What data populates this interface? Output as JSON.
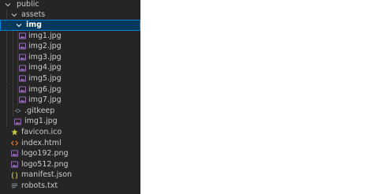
{
  "explorer": {
    "tree": {
      "public": "public",
      "assets": "assets",
      "img": "img",
      "img_files": [
        "img1.jpg",
        "img2.jpg",
        "img3.jpg",
        "img4.jpg",
        "img5.jpg",
        "img6.jpg",
        "img7.jpg"
      ],
      "gitkeep": ".gitkeep",
      "assets_img1": "img1.jpg",
      "favicon": "favicon.ico",
      "index": "index.html",
      "logo192": "logo192.png",
      "logo512": "logo512.png",
      "manifest": "manifest.json",
      "robots": "robots.txt"
    }
  },
  "colors": {
    "sidebar_bg": "#252526",
    "selection_bg": "#04395e",
    "selection_border": "#007fd4",
    "image_icon": "#a074c4",
    "favicon_icon": "#cbcb41",
    "html_icon": "#e37933",
    "json_icon": "#cbcb41",
    "text_icon": "#9aa5b1",
    "gitkeep_icon": "#6d8086"
  }
}
